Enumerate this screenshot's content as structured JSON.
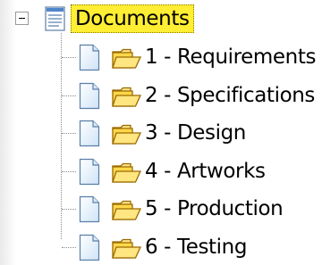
{
  "tree": {
    "root": {
      "label": "Documents",
      "expanded": true,
      "selected": true,
      "icon": "document-list-icon",
      "expander_icon": "collapse-minus-icon"
    },
    "children": [
      {
        "label": "1 - Requirements",
        "page_icon": "page-icon",
        "folder_icon": "open-folder-icon"
      },
      {
        "label": "2 - Specifications",
        "page_icon": "page-icon",
        "folder_icon": "open-folder-icon"
      },
      {
        "label": "3 - Design",
        "page_icon": "page-icon",
        "folder_icon": "open-folder-icon"
      },
      {
        "label": "4 - Artworks",
        "page_icon": "page-icon",
        "folder_icon": "open-folder-icon"
      },
      {
        "label": "5 - Production",
        "page_icon": "page-icon",
        "folder_icon": "open-folder-icon"
      },
      {
        "label": "6 - Testing",
        "page_icon": "page-icon",
        "folder_icon": "open-folder-icon"
      }
    ]
  },
  "colors": {
    "selection_background": "#ffee33",
    "connector_lines": "#8c8c8c",
    "folder_fill": "#ffd84a",
    "folder_outline": "#9a6a00",
    "page_fill": "#e6f2ff",
    "page_outline": "#5a7fa8"
  }
}
